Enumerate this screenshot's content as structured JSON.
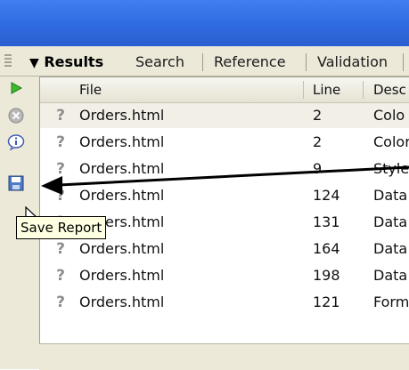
{
  "tabs": [
    {
      "label": "Results",
      "active": true
    },
    {
      "label": "Search",
      "active": false
    },
    {
      "label": "Reference",
      "active": false
    },
    {
      "label": "Validation",
      "active": false
    }
  ],
  "toolbar_icons": [
    {
      "name": "play-icon"
    },
    {
      "name": "stop-icon"
    },
    {
      "name": "info-icon"
    },
    {
      "name": "save-report-icon"
    }
  ],
  "table": {
    "headers": {
      "file": "File",
      "line": "Line",
      "desc": "Desc"
    },
    "rows": [
      {
        "icon": "?",
        "file": "Orders.html",
        "line": "2",
        "desc": "Colo"
      },
      {
        "icon": "?",
        "file": "Orders.html",
        "line": "2",
        "desc": "Color"
      },
      {
        "icon": "?",
        "file": "Orders.html",
        "line": "9",
        "desc": "Style"
      },
      {
        "icon": "?",
        "file": "Orders.html",
        "line": "124",
        "desc": "Data"
      },
      {
        "icon": "?",
        "file": "Orders.html",
        "line": "131",
        "desc": "Data"
      },
      {
        "icon": "?",
        "file": "Orders.html",
        "line": "164",
        "desc": "Data"
      },
      {
        "icon": "?",
        "file": "Orders.html",
        "line": "198",
        "desc": "Data"
      },
      {
        "icon": "?",
        "file": "Orders.html",
        "line": "121",
        "desc": "Form"
      }
    ]
  },
  "tooltip": {
    "text": "Save Report"
  },
  "colors": {
    "accent": "#2f6be0",
    "panel": "#ece9d8",
    "tooltip_bg": "#ffffe1"
  }
}
